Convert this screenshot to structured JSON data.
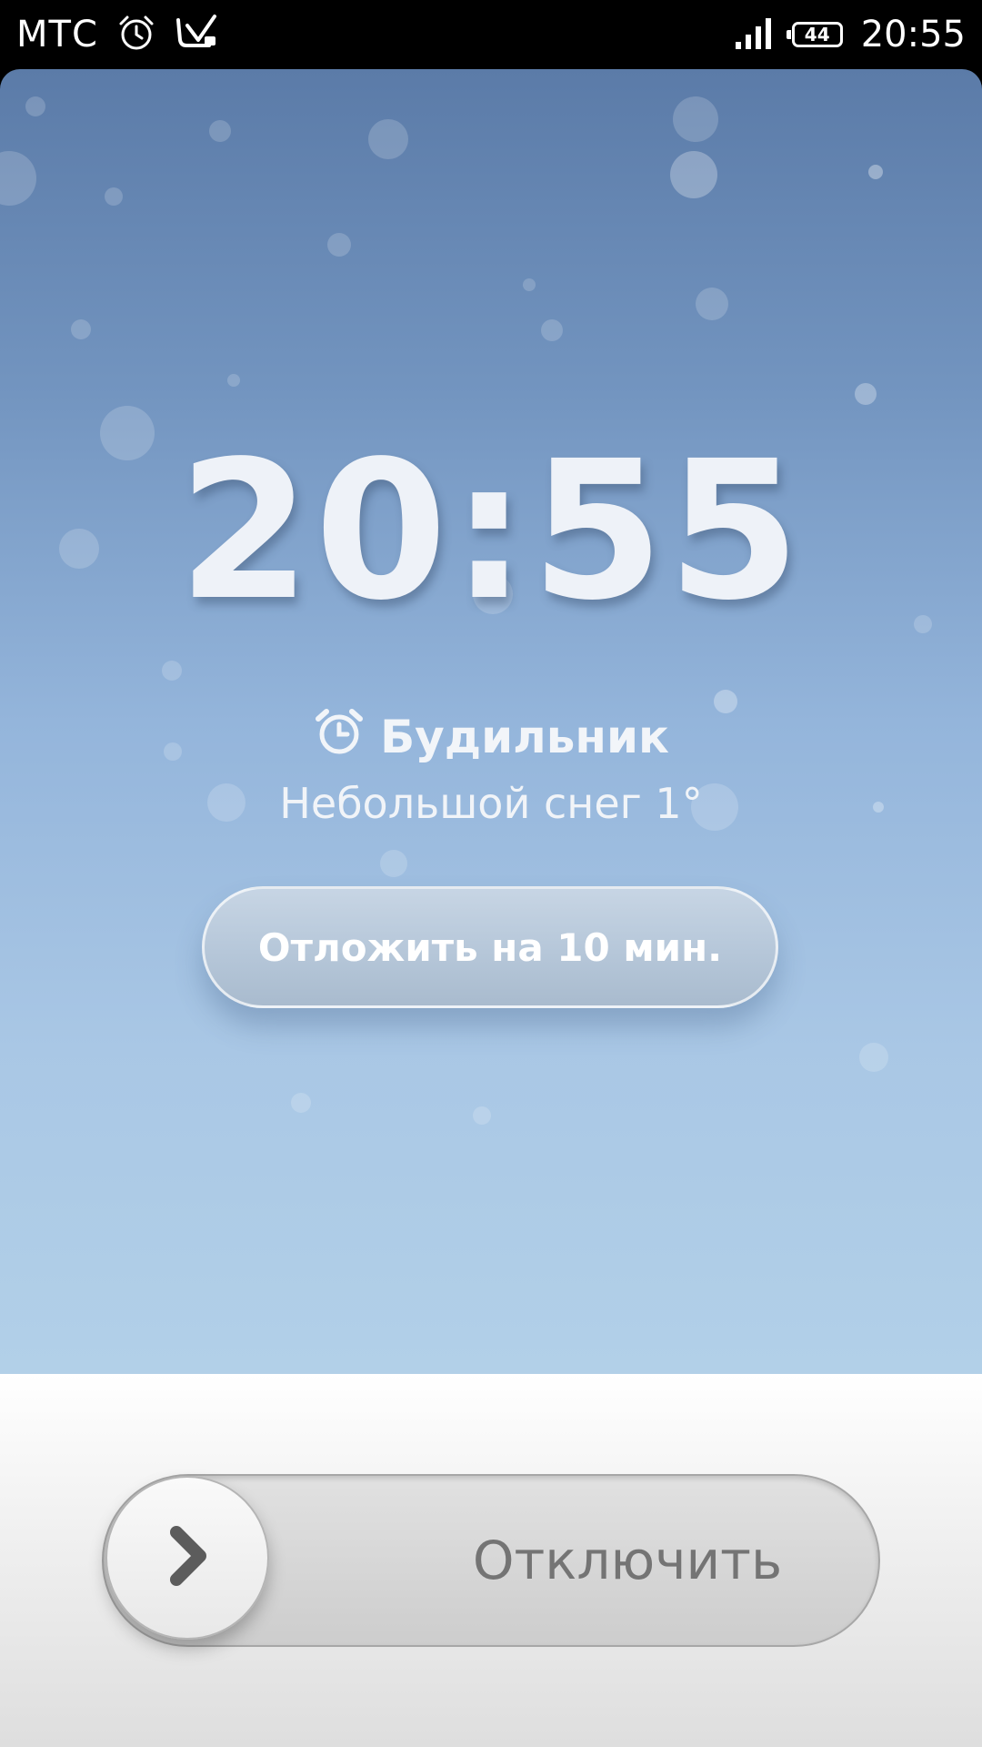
{
  "status_bar": {
    "carrier": "МТС",
    "time": "20:55",
    "battery_level": "44",
    "icons": [
      "alarm-clock-icon",
      "vibrate-off-icon",
      "signal-bars-icon",
      "battery-icon"
    ]
  },
  "alarm": {
    "time": "20:55",
    "label": "Будильник",
    "weather": "Небольшой снег 1°",
    "snooze_button": "Отложить на 10 мин.",
    "dismiss_label": "Отключить"
  },
  "colors": {
    "sky_top": "#5b7ba8",
    "sky_bottom": "#b2d0e8",
    "bottom_panel": "#f1f1f1",
    "status_bar": "#000000"
  }
}
